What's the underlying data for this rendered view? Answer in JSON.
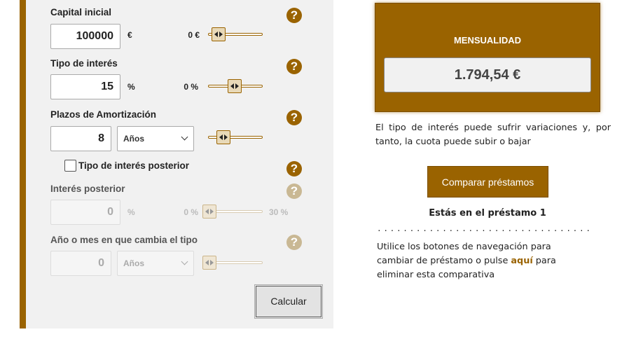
{
  "form": {
    "capital": {
      "label": "Capital inicial",
      "value": "100000",
      "unit": "€",
      "min": "0 €",
      "slider_level": 0.2
    },
    "interest": {
      "label": "Tipo de interés",
      "value": "15",
      "unit": "%",
      "min": "0 %",
      "slider_level": 0.5
    },
    "term": {
      "label": "Plazos de Amortización",
      "value": "8",
      "period": "Años",
      "slider_level": 0.2
    },
    "later_checkbox_label": "Tipo de interés posterior",
    "later_checked": false,
    "later_interest": {
      "label": "Interés posterior",
      "value": "0",
      "unit": "%",
      "min": "0 %",
      "max": "30 %",
      "slider_level": 0
    },
    "change_when": {
      "label": "Año o mes en que cambia el tipo",
      "value": "0",
      "period": "Años",
      "slider_level": 0
    },
    "help_symbol": "?",
    "calc_button": "Calcular"
  },
  "result": {
    "title": "MENSUALIDAD",
    "value": "1.794,54 €",
    "note": "El tipo de interés puede sufrir variaciones y, por tanto, la cuota puede subir o bajar",
    "compare_button": "Comparar préstamos",
    "current_loan": "Estás en el préstamo 1",
    "separator": "...............................................",
    "nav_before": "Utilice los botones de navegación para cambiar de préstamo o pulse ",
    "nav_link": "aquí",
    "nav_after": " para eliminar esta comparativa"
  },
  "colors": {
    "accent": "#9a6300",
    "panel": "#f1f1f1",
    "disabled_help": "#c9b894"
  },
  "icons": {
    "help": "question-circle-icon",
    "select": "chevron-down-icon",
    "slider_handle": "double-arrow-handle-icon"
  }
}
